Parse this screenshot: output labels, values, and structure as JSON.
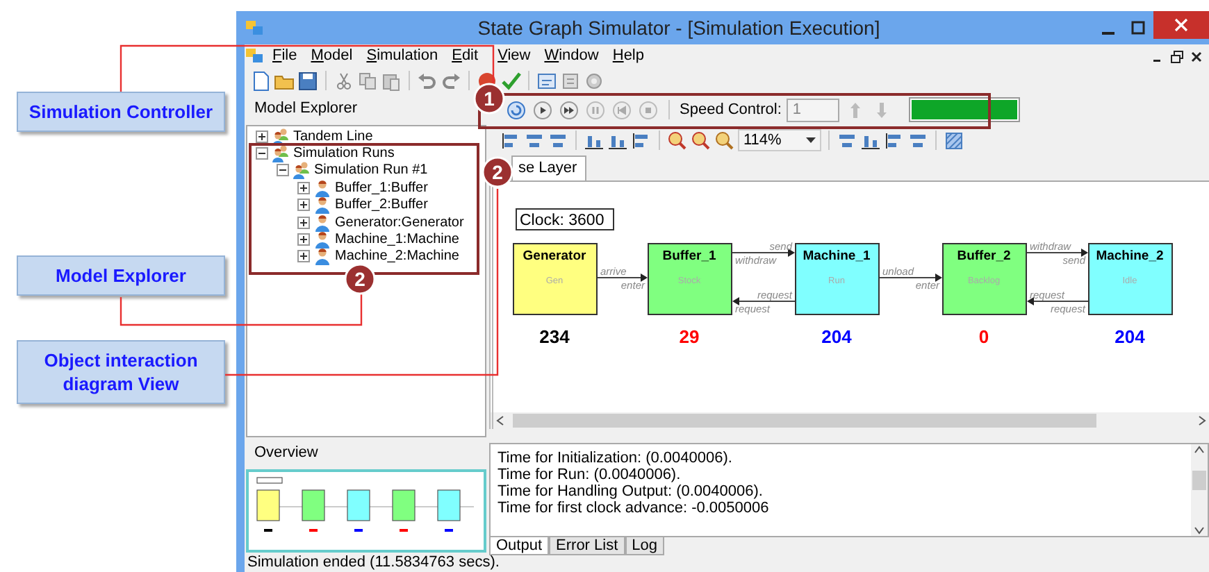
{
  "annotations": [
    {
      "text": "Simulation Controller",
      "badge": "1"
    },
    {
      "text": "Model Explorer",
      "badge": "2"
    },
    {
      "text": "Object interaction diagram View",
      "badge": "2"
    }
  ],
  "window": {
    "title": "State Graph Simulator - [Simulation Execution]"
  },
  "menu": [
    "File",
    "Model",
    "Simulation",
    "Edit",
    "View",
    "Window",
    "Help"
  ],
  "simulation_toolbar": {
    "speed_label": "Speed Control:",
    "speed_value": "1",
    "speed_bar": {
      "level": 1
    }
  },
  "diagram_toolbar": {
    "zoom": "114%"
  },
  "model_explorer": {
    "title": "Model Explorer",
    "tree": [
      {
        "label": "Tandem Line",
        "kind": "group",
        "expanded": false
      },
      {
        "label": "Simulation Runs",
        "kind": "group",
        "expanded": true,
        "children": [
          {
            "label": "Simulation Run #1",
            "kind": "group",
            "expanded": true,
            "children": [
              {
                "label": "Buffer_1:Buffer",
                "kind": "object",
                "expanded": false
              },
              {
                "label": "Buffer_2:Buffer",
                "kind": "object",
                "expanded": false
              },
              {
                "label": "Generator:Generator",
                "kind": "object",
                "expanded": false
              },
              {
                "label": "Machine_1:Machine",
                "kind": "object",
                "expanded": false
              },
              {
                "label": "Machine_2:Machine",
                "kind": "object",
                "expanded": false
              }
            ]
          }
        ]
      }
    ]
  },
  "overview": {
    "title": "Overview"
  },
  "tabs": [
    {
      "label": "se Layer",
      "selected": true
    }
  ],
  "diagram": {
    "clock": "Clock: 3600",
    "nodes": [
      {
        "name": "Generator",
        "state": "Gen",
        "color": "#ffff80",
        "count": {
          "text": "234",
          "color": "#000000"
        }
      },
      {
        "name": "Buffer_1",
        "state": "Stock",
        "color": "#80ff80",
        "count": {
          "text": "29",
          "color": "#ff0000"
        }
      },
      {
        "name": "Machine_1",
        "state": "Run",
        "color": "#80ffff",
        "count": {
          "text": "204",
          "color": "#0000ff"
        }
      },
      {
        "name": "Buffer_2",
        "state": "Backlog",
        "color": "#80ff80",
        "count": {
          "text": "0",
          "color": "#ff0000"
        }
      },
      {
        "name": "Machine_2",
        "state": "Idle",
        "color": "#80ffff",
        "count": {
          "text": "204",
          "color": "#0000ff"
        }
      }
    ],
    "links": [
      {
        "arrows": [
          {
            "reverse": false,
            "labels": [
              {
                "text": "arrive",
                "above": true,
                "right": false
              },
              {
                "text": "enter",
                "above": false,
                "right": true
              }
            ]
          }
        ]
      },
      {
        "arrows": [
          {
            "reverse": false,
            "labels": [
              {
                "text": "send",
                "above": true,
                "right": true
              },
              {
                "text": "withdraw",
                "above": false,
                "right": false
              }
            ]
          },
          {
            "reverse": true,
            "labels": [
              {
                "text": "request",
                "above": true,
                "right": true
              },
              {
                "text": "request",
                "above": false,
                "right": false
              }
            ]
          }
        ]
      },
      {
        "arrows": [
          {
            "reverse": false,
            "labels": [
              {
                "text": "unload",
                "above": true,
                "right": false
              },
              {
                "text": "enter",
                "above": false,
                "right": true
              }
            ]
          }
        ]
      },
      {
        "arrows": [
          {
            "reverse": false,
            "labels": [
              {
                "text": "withdraw",
                "above": true,
                "right": false
              },
              {
                "text": "send",
                "above": false,
                "right": true
              }
            ]
          },
          {
            "reverse": true,
            "labels": [
              {
                "text": "request",
                "above": true,
                "right": false
              },
              {
                "text": "request",
                "above": false,
                "right": true
              }
            ]
          }
        ]
      }
    ]
  },
  "output": {
    "lines": [
      "Time for Initialization: (0.0040006).",
      "Time for Run: (0.0040006).",
      "Time for Handling Output: (0.0040006).",
      "Time for first clock advance: -0.0050006"
    ],
    "tabs": [
      {
        "label": "Output",
        "selected": true
      },
      {
        "label": "Error List",
        "selected": false
      },
      {
        "label": "Log",
        "selected": false
      }
    ]
  },
  "status_bar": "Simulation ended (11.5834763 secs)."
}
